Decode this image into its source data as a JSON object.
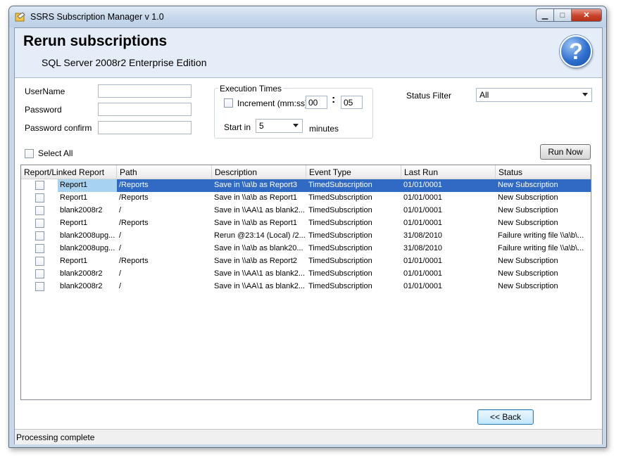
{
  "window": {
    "title": "SSRS Subscription Manager v 1.0",
    "btn_min": "▁",
    "btn_max": "□",
    "btn_close": "✕"
  },
  "header": {
    "title": "Rerun subscriptions",
    "subtitle": "SQL Server 2008r2 Enterprise Edition",
    "help_glyph": "?"
  },
  "form": {
    "username_label": "UserName",
    "username_value": "",
    "password_label": "Password",
    "password_value": "",
    "confirm_label": "Password confirm",
    "confirm_value": "",
    "exec_group_title": "Execution Times",
    "increment_label": "Increment (mm:ss)",
    "increment_min": "00",
    "colon": ":",
    "increment_sec": "05",
    "start_in_label": "Start in",
    "start_in_value": "5",
    "minutes_label": "minutes",
    "status_filter_label": "Status Filter",
    "status_filter_value": "All",
    "select_all_label": "Select All",
    "run_now_label": "Run Now",
    "back_label": "<< Back"
  },
  "table": {
    "columns": [
      "Report/Linked Report",
      "Path",
      "Description",
      "Event Type",
      "Last Run",
      "Status"
    ],
    "rows": [
      [
        "Report1",
        "/Reports",
        "Save in \\\\a\\b as Report3",
        "TimedSubscription",
        "01/01/0001",
        "New Subscription"
      ],
      [
        "Report1",
        "/Reports",
        "Save in \\\\a\\b as Report1",
        "TimedSubscription",
        "01/01/0001",
        "New Subscription"
      ],
      [
        "blank2008r2",
        "/",
        "Save in \\\\AA\\1 as blank2...",
        "TimedSubscription",
        "01/01/0001",
        "New Subscription"
      ],
      [
        "Report1",
        "/Reports",
        "Save in \\\\a\\b as Report1",
        "TimedSubscription",
        "01/01/0001",
        "New Subscription"
      ],
      [
        "blank2008upg...",
        "/",
        "Rerun @23:14 (Local) /2...",
        "TimedSubscription",
        "31/08/2010",
        "Failure writing file \\\\a\\b\\..."
      ],
      [
        "blank2008upg...",
        "/",
        "Save in \\\\a\\b as blank20...",
        "TimedSubscription",
        "31/08/2010",
        "Failure writing file \\\\a\\b\\..."
      ],
      [
        "Report1",
        "/Reports",
        "Save in \\\\a\\b as Report2",
        "TimedSubscription",
        "01/01/0001",
        "New Subscription"
      ],
      [
        "blank2008r2",
        "/",
        "Save in \\\\AA\\1 as blank2...",
        "TimedSubscription",
        "01/01/0001",
        "New Subscription"
      ],
      [
        "blank2008r2",
        "/",
        "Save in \\\\AA\\1 as blank2...",
        "TimedSubscription",
        "01/01/0001",
        "New Subscription"
      ]
    ]
  },
  "statusbar": {
    "text": "Processing complete"
  }
}
